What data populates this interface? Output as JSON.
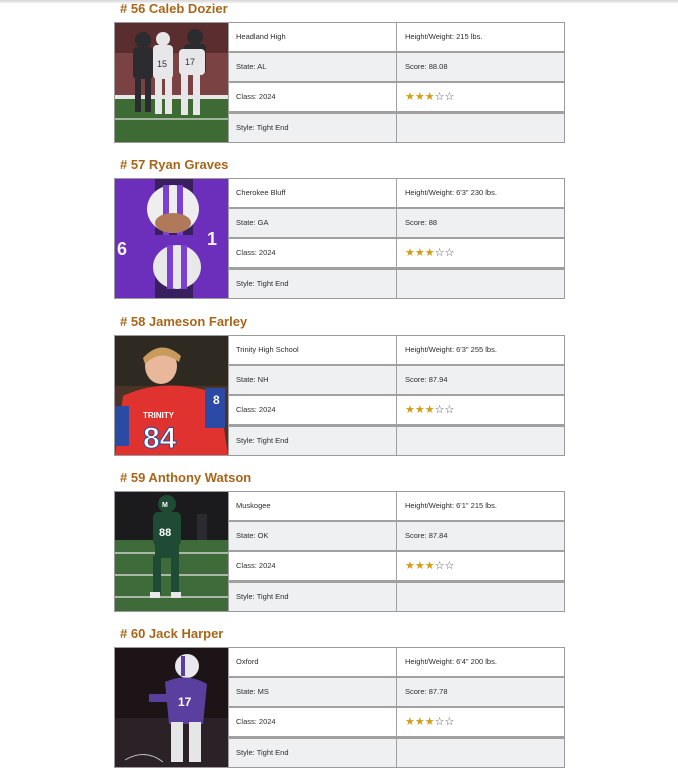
{
  "players": [
    {
      "title": "# 56 Caleb Dozier",
      "school": "Headland High",
      "state": "State: AL",
      "class": "Class: 2024",
      "style": "Style: Tight End",
      "height_weight": "Height/Weight:   215 lbs.",
      "score": "Score: 88.08",
      "stars": {
        "filled": 3,
        "total": 5
      },
      "photo": {
        "description_icon": "football-players-photo",
        "jersey_color": "#2e2e34",
        "bg": "#6b3b3c"
      }
    },
    {
      "title": "# 57 Ryan Graves",
      "school": "Cherokee Bluff",
      "state": "State: GA",
      "class": "Class: 2024",
      "style": "Style: Tight End",
      "height_weight": "Height/Weight: 6'3\"  230 lbs.",
      "score": "Score: 88",
      "stars": {
        "filled": 3,
        "total": 5
      },
      "photo": {
        "description_icon": "football-players-photo",
        "jersey_color": "#6a2fb8",
        "bg": "#3a1f5e"
      }
    },
    {
      "title": "# 58 Jameson Farley",
      "school": "Trinity High School",
      "state": "State: NH",
      "class": "Class: 2024",
      "style": "Style: Tight End",
      "height_weight": "Height/Weight: 6'3\"  255 lbs.",
      "score": "Score: 87.94",
      "stars": {
        "filled": 3,
        "total": 5
      },
      "photo": {
        "description_icon": "football-player-photo",
        "jersey_color": "#e0322e",
        "bg": "#3b2a22"
      }
    },
    {
      "title": "# 59 Anthony Watson",
      "school": "Muskogee",
      "state": "State: OK",
      "class": "Class: 2024",
      "style": "Style: Tight End",
      "height_weight": "Height/Weight: 6'1\"  215 lbs.",
      "score": "Score: 87.84",
      "stars": {
        "filled": 3,
        "total": 5
      },
      "photo": {
        "description_icon": "football-player-photo",
        "jersey_color": "#1f4a33",
        "bg": "#1a1a1d"
      }
    },
    {
      "title": "# 60 Jack Harper",
      "school": "Oxford",
      "state": "State: MS",
      "class": "Class: 2024",
      "style": "Style: Tight End",
      "height_weight": "Height/Weight: 6'4\"  200 lbs.",
      "score": "Score: 87.78",
      "stars": {
        "filled": 3,
        "total": 5
      },
      "photo": {
        "description_icon": "football-player-photo",
        "jersey_color": "#5a3f9e",
        "bg": "#1d1418"
      }
    }
  ],
  "colors": {
    "title": "#a8661b",
    "star_filled": "#d29d12",
    "star_empty": "#555555",
    "cell_bg": "#eff0f2",
    "border": "#9b9b9b"
  }
}
